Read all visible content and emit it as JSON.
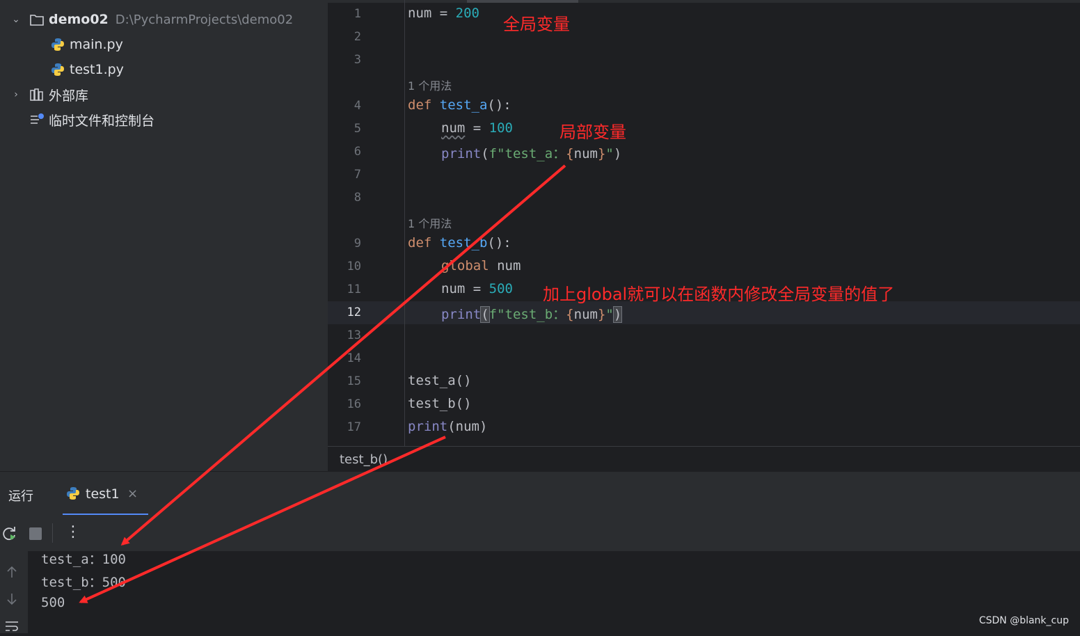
{
  "project_tree": {
    "root": {
      "name": "demo02",
      "path": "D:\\PycharmProjects\\demo02"
    },
    "files": [
      "main.py",
      "test1.py"
    ],
    "external_libs": "外部库",
    "scratches": "临时文件和控制台"
  },
  "editor": {
    "line_numbers": [
      "1",
      "2",
      "3",
      "4",
      "5",
      "6",
      "7",
      "8",
      "9",
      "10",
      "11",
      "12",
      "13",
      "14",
      "15",
      "16",
      "17"
    ],
    "active_line": "12",
    "usage_hint": "1 个用法",
    "code": {
      "l1_var": "num",
      "l1_op": " = ",
      "l1_val": "200",
      "l4_kw": "def",
      "l4_fn": "test_a",
      "l4_rest": "():",
      "l5_var": "num",
      "l5_op": " = ",
      "l5_val": "100",
      "l6_print": "print",
      "l6_open": "(",
      "l6_str": "f\"test_a：",
      "l6_brace_open": "{",
      "l6_var": "num",
      "l6_brace_close": "}",
      "l6_str_end": "\"",
      "l6_close": ")",
      "l9_kw": "def",
      "l9_fn": "test_b",
      "l9_rest": "():",
      "l10_kw": "global",
      "l10_var": " num",
      "l11_var": "num",
      "l11_op": " = ",
      "l11_val": "500",
      "l12_print": "print",
      "l12_open": "(",
      "l12_str": "f\"test_b：",
      "l12_brace_open": "{",
      "l12_var": "num",
      "l12_brace_close": "}",
      "l12_str_end": "\"",
      "l12_close": ")",
      "l15": "test_a()",
      "l16": "test_b()",
      "l17_print": "print",
      "l17_rest": "(num)"
    },
    "annotations": {
      "global_var": "全局变量",
      "local_var": "局部变量",
      "global_note": "加上global就可以在函数内修改全局变量的值了"
    },
    "breadcrumb": "test_b()"
  },
  "run_panel": {
    "title": "运行",
    "tab_label": "test1",
    "close_glyph": "×",
    "more_glyph": "⋮",
    "output": [
      "test_a：100",
      "test_b：500",
      "500"
    ]
  },
  "watermark": "CSDN @blank_cup",
  "colors": {
    "keyword": "#cf8e6d",
    "function": "#56a8f5",
    "number": "#2aacb8",
    "string": "#6aab73",
    "builtin": "#8888c6",
    "annotation": "#ff2a2a"
  }
}
